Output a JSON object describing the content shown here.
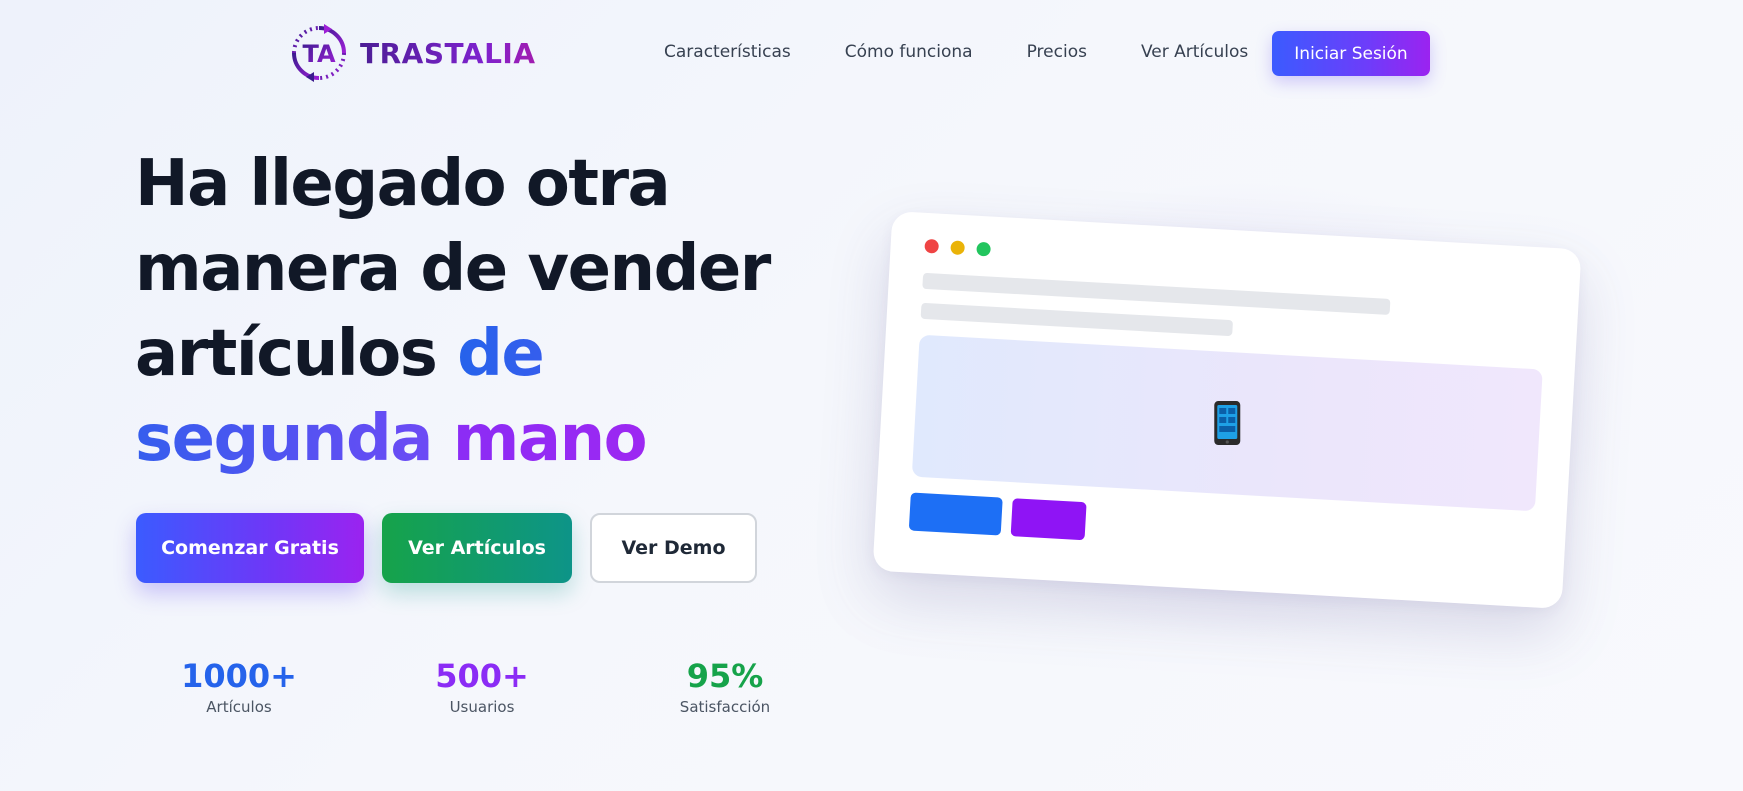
{
  "brand": {
    "name": "TRASTALIA",
    "logo_initials": "TA"
  },
  "nav": {
    "links": [
      "Características",
      "Cómo funciona",
      "Precios",
      "Ver Artículos"
    ],
    "login_label": "Iniciar Sesión"
  },
  "hero": {
    "title_part1": "Ha llegado otra manera de vender artículos",
    "title_highlight1": "de segunda",
    "title_highlight2": "mano",
    "cta_primary": "Comenzar Gratis",
    "cta_secondary": "Ver Artículos",
    "cta_demo": "Ver Demo"
  },
  "stats": [
    {
      "value": "1000+",
      "label": "Artículos"
    },
    {
      "value": "500+",
      "label": "Usuarios"
    },
    {
      "value": "95%",
      "label": "Satisfacción"
    }
  ],
  "colors": {
    "primary_blue": "#2563eb",
    "accent_purple": "#8b2cf5",
    "success_green": "#16a34a",
    "dark_text": "#111827"
  },
  "mockup": {
    "icon": "mobile-phone-icon"
  }
}
